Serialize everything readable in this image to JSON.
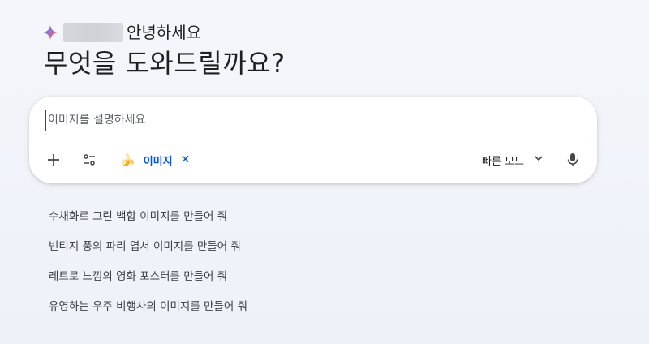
{
  "greeting": {
    "hello": "안녕하세요",
    "headline": "무엇을 도와드릴까요?"
  },
  "composer": {
    "placeholder": "이미지를 설명하세요",
    "value": "",
    "chip": {
      "emoji": "🍌",
      "label": "이미지",
      "close": "✕"
    },
    "mode": {
      "label": "빠른 모드"
    },
    "icons": {
      "add": "plus-icon",
      "tools": "tools-icon",
      "mode_dropdown": "chevron-down-icon",
      "mic": "mic-icon"
    }
  },
  "suggestions": [
    "수채화로 그린 백합 이미지를 만들어 줘",
    "빈티지 풍의 파리 엽서 이미지를 만들어 줘",
    "레트로 느낌의 영화 포스터를 만들어 줘",
    "유영하는 우주 비행사의 이미지를 만들어 줘"
  ],
  "colors": {
    "accent": "#0b57d0",
    "text": "#1f1f1f",
    "muted": "#5f6368"
  }
}
